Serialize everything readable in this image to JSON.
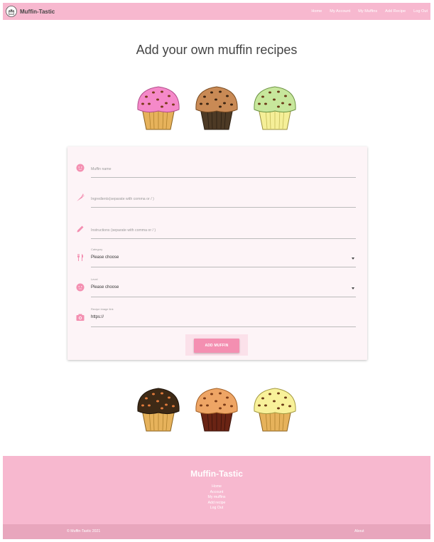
{
  "navbar": {
    "brand": "Muffin-Tastic",
    "links": [
      "Home",
      "My Account",
      "My Muffins",
      "Add Recipe",
      "Log Out"
    ]
  },
  "page": {
    "title": "Add your own muffin recipes"
  },
  "form": {
    "muffin_name": {
      "placeholder": "Muffin name",
      "icon": "face-icon"
    },
    "ingredients": {
      "placeholder": "Ingredients(separate with comma or / )",
      "icon": "carrot-icon"
    },
    "instructions": {
      "placeholder": "Instructions (separate with comma or / )",
      "icon": "pencil-icon"
    },
    "category": {
      "label": "Category",
      "value": "Please choose",
      "icon": "fork-knife-icon"
    },
    "level": {
      "label": "Level",
      "value": "Please choose",
      "icon": "mood-icon"
    },
    "image": {
      "label": "Recipe image link",
      "value": "https://",
      "icon": "camera-icon"
    },
    "submit_label": "ADD MUFFIN"
  },
  "footer": {
    "title": "Muffin-Tastic",
    "links": [
      "Home",
      "Account",
      "My muffins",
      "Add recipe",
      "Log Out"
    ],
    "copyright": "© Muffin-Tastic 2021",
    "about": "About"
  },
  "colors": {
    "primary_pink": "#f7b8cf",
    "button_pink": "#f48fb1",
    "footer_bottom": "#e8a6bd"
  }
}
